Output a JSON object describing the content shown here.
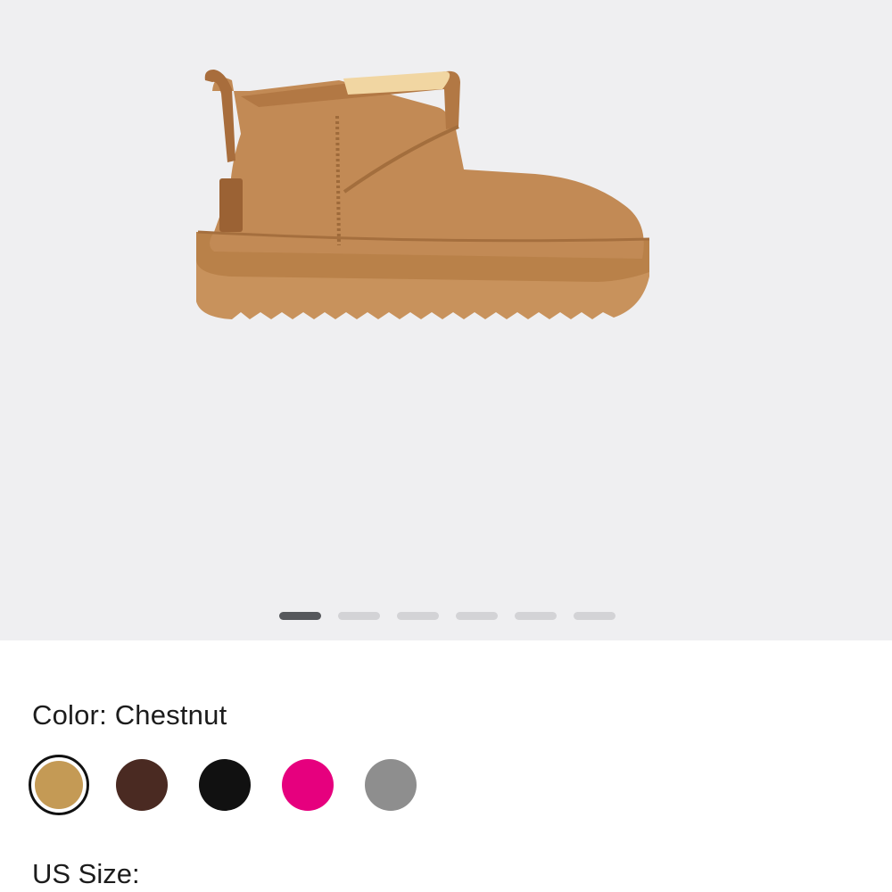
{
  "gallery": {
    "background": "#efeff1",
    "image_alt": "Chestnut mini boot",
    "slide_count": 6,
    "active_slide": 0
  },
  "color": {
    "label_prefix": "Color:",
    "selected_name": "Chestnut",
    "label": "Color: Chestnut",
    "swatches": [
      {
        "name": "Chestnut",
        "hex": "#c49a55",
        "selected": true
      },
      {
        "name": "Dark Brown",
        "hex": "#4a2a22",
        "selected": false
      },
      {
        "name": "Black",
        "hex": "#111111",
        "selected": false
      },
      {
        "name": "Pink",
        "hex": "#e6007e",
        "selected": false
      },
      {
        "name": "Grey",
        "hex": "#8e8e8e",
        "selected": false
      }
    ]
  },
  "size": {
    "label": "US Size:"
  }
}
